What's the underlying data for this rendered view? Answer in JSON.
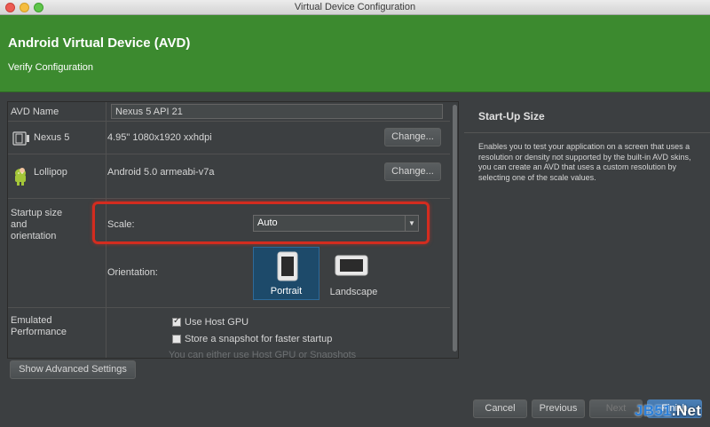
{
  "window": {
    "title": "Virtual Device Configuration"
  },
  "header": {
    "title": "Android Virtual Device (AVD)",
    "subtitle": "Verify Configuration"
  },
  "form": {
    "avd_name": {
      "label": "AVD Name",
      "value": "Nexus 5 API 21"
    },
    "device": {
      "label": "Nexus 5",
      "value": "4.95\" 1080x1920 xxhdpi",
      "button": "Change...",
      "icon": "phone-icon"
    },
    "system_image": {
      "label": "Lollipop",
      "value": "Android 5.0 armeabi-v7a",
      "button": "Change...",
      "icon": "android-icon"
    },
    "startup": {
      "label_line1": "Startup size",
      "label_line2": "and",
      "label_line3": "orientation",
      "scale_label": "Scale:",
      "scale_value": "Auto",
      "orientation_label": "Orientation:",
      "portrait": "Portrait",
      "landscape": "Landscape",
      "selected": "Portrait"
    },
    "performance": {
      "label_line1": "Emulated",
      "label_line2": "Performance",
      "use_host_gpu": {
        "label": "Use Host GPU",
        "checked": true
      },
      "snapshot": {
        "label": "Store a snapshot for faster startup",
        "checked": false
      },
      "hint": "You can either use Host GPU or Snapshots"
    }
  },
  "show_advanced": "Show Advanced Settings",
  "help": {
    "title": "Start-Up Size",
    "description": "Enables you to test your application on a screen that uses a resolution or density not supported by the built-in AVD skins, you can create an AVD that uses a custom resolution by selecting one of the scale values."
  },
  "footer": {
    "cancel": "Cancel",
    "previous": "Previous",
    "next": "Next",
    "finish": "Finish"
  },
  "watermark": {
    "part1": "JB51",
    "part2": ".Net"
  },
  "colors": {
    "header": "#3c8a2f",
    "highlight": "#d42c1f",
    "selected_orientation": "#1d4a6a"
  }
}
